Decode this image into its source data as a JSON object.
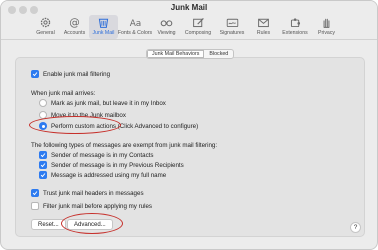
{
  "window": {
    "title": "Junk Mail"
  },
  "toolbar": {
    "items": [
      {
        "label": "General",
        "icon": "gear-icon"
      },
      {
        "label": "Accounts",
        "icon": "at-sign-icon"
      },
      {
        "label": "Junk Mail",
        "icon": "junk-bin-icon",
        "active": true
      },
      {
        "label": "Fonts & Colors",
        "icon": "font-aa-icon"
      },
      {
        "label": "Viewing",
        "icon": "glasses-icon"
      },
      {
        "label": "Composing",
        "icon": "compose-icon"
      },
      {
        "label": "Signatures",
        "icon": "signature-icon"
      },
      {
        "label": "Rules",
        "icon": "rules-envelope-icon"
      },
      {
        "label": "Extensions",
        "icon": "extensions-icon"
      },
      {
        "label": "Privacy",
        "icon": "hand-privacy-icon"
      }
    ]
  },
  "tabs": [
    {
      "label": "Junk Mail Behaviors",
      "selected": true
    },
    {
      "label": "Blocked",
      "selected": false
    }
  ],
  "settings": {
    "enable_filtering": {
      "label": "Enable junk mail filtering",
      "checked": true
    },
    "when_arrives_heading": "When junk mail arrives:",
    "arrival_options": [
      {
        "label": "Mark as junk mail, but leave it in my Inbox",
        "selected": false
      },
      {
        "label": "Move it to the Junk mailbox",
        "selected": false
      },
      {
        "label": "Perform custom actions (Click Advanced to configure)",
        "selected": true
      }
    ],
    "exempt_heading": "The following types of messages are exempt from junk mail filtering:",
    "exempt_options": [
      {
        "label": "Sender of message is in my Contacts",
        "checked": true
      },
      {
        "label": "Sender of message is in my Previous Recipients",
        "checked": true
      },
      {
        "label": "Message is addressed using my full name",
        "checked": true
      }
    ],
    "trust_headers": {
      "label": "Trust junk mail headers in messages",
      "checked": true
    },
    "filter_before_rules": {
      "label": "Filter junk mail before applying my rules",
      "checked": false
    }
  },
  "buttons": {
    "reset": "Reset...",
    "advanced": "Advanced...",
    "help": "?"
  },
  "annotation_color": "#c6302b",
  "accent_color": "#2d7bf0"
}
